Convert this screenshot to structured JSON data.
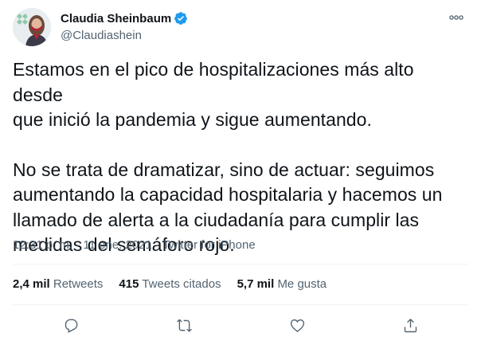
{
  "author": {
    "display_name": "Claudia Sheinbaum",
    "handle": "@Claudiashein",
    "verified": true,
    "avatar_icon": "profile-photo"
  },
  "tweet": {
    "paragraph_1_line_1": "Estamos en el pico de hospitalizaciones más alto desde",
    "paragraph_1_line_2": "que inició la pandemia y sigue aumentando.",
    "paragraph_2_line_1": "No se trata de dramatizar, sino de actuar: seguimos",
    "paragraph_2_line_2": "aumentando la capacidad hospitalaria y hacemos un",
    "paragraph_2_line_3": "llamado de alerta a la ciudadanía para cumplir las",
    "paragraph_2_line_4": "medidas del semáforo rojo."
  },
  "meta": {
    "time": "12:31 p. m.",
    "separator": " · ",
    "date": "11 ene. 2021",
    "source": "Twitter for iPhone"
  },
  "stats": {
    "retweets_count": "2,4 mil",
    "retweets_label": "Retweets",
    "quotes_count": "415",
    "quotes_label": "Tweets citados",
    "likes_count": "5,7 mil",
    "likes_label": "Me gusta"
  },
  "icons": {
    "more": "more-icon",
    "reply": "reply-icon",
    "retweet": "retweet-icon",
    "like": "heart-icon",
    "share": "share-icon",
    "verified": "verified-badge-icon"
  },
  "colors": {
    "text": "#0f1419",
    "secondary": "#536471",
    "verified_blue": "#1d9bf0",
    "divider": "#eff3f4"
  }
}
